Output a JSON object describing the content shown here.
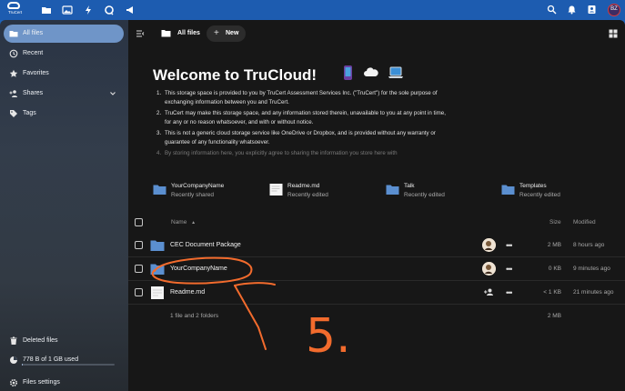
{
  "topbar": {
    "logo_text": "TruCert",
    "apps": [
      "files-icon",
      "photos-icon",
      "activity-icon",
      "talk-icon",
      "announcements-icon"
    ],
    "user_initials": "BZ"
  },
  "sidebar": {
    "items": [
      {
        "label": "All files",
        "icon": "folder-icon"
      },
      {
        "label": "Recent",
        "icon": "history-icon"
      },
      {
        "label": "Favorites",
        "icon": "star-icon"
      },
      {
        "label": "Shares",
        "icon": "share-icon"
      },
      {
        "label": "Tags",
        "icon": "tag-icon"
      }
    ],
    "deleted": "Deleted files",
    "quota": "778 B of 1 GB used",
    "quota_fraction": 0.01,
    "settings": "Files settings"
  },
  "main": {
    "breadcrumb": "All files",
    "new_button": "New",
    "welcome": {
      "title": "Welcome to TruCloud!",
      "notes": [
        {
          "num": "1.",
          "text": "This storage space is provided to you by TruCert Assessment Services Inc. (\"TruCert\") for the sole purpose of exchanging information between you and TruCert."
        },
        {
          "num": "2.",
          "text": "TruCert may make this storage space, and any information stored therein, unavailable to you at any point in time, for any or no reason whatsoever, and with or without notice."
        },
        {
          "num": "3.",
          "text": "This is not a generic cloud storage service like OneDrive or Dropbox, and is provided without any warranty or guarantee of any functionality whatsoever."
        },
        {
          "num": "4.",
          "text": "By storing information here, you explicitly agree to sharing the information you store here with"
        }
      ]
    },
    "recent": [
      {
        "name": "YourCompanyName",
        "sub": "Recently shared",
        "type": "folder"
      },
      {
        "name": "Readme.md",
        "sub": "Recently edited",
        "type": "doc"
      },
      {
        "name": "Talk",
        "sub": "Recently edited",
        "type": "folder"
      },
      {
        "name": "Templates",
        "sub": "Recently edited",
        "type": "folder"
      }
    ],
    "table": {
      "col_name": "Name",
      "col_size": "Size",
      "col_modified": "Modified",
      "rows": [
        {
          "name": "CEC Document Package",
          "size": "2 MB",
          "modified": "8 hours ago",
          "type": "folder"
        },
        {
          "name": "YourCompanyName",
          "size": "0 KB",
          "modified": "9 minutes ago",
          "type": "folder"
        },
        {
          "name": "Readme.md",
          "size": "< 1 KB",
          "modified": "21 minutes ago",
          "type": "doc"
        }
      ],
      "summary": "1 file and 2 folders",
      "summary_size": "2 MB"
    }
  },
  "annotation": {
    "step_label": "5.",
    "color": "#f26b2d"
  }
}
